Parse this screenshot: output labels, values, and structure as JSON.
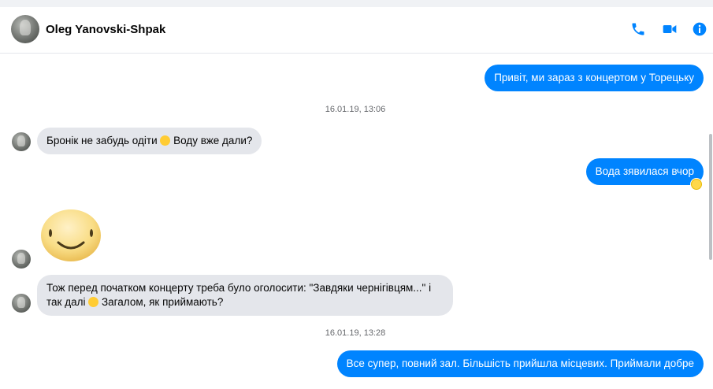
{
  "header": {
    "contact_name": "Oleg Yanovski-Shpak",
    "icons": [
      "phone-icon",
      "video-icon",
      "info-icon"
    ],
    "accent_color": "#0084ff"
  },
  "messages": [
    {
      "side": "out",
      "text": "Привіт, ми зараз з концертом у Торецьку"
    },
    {
      "type": "timestamp",
      "text": "16.01.19, 13:06"
    },
    {
      "side": "in",
      "text_before": "Бронік не забудь одіти",
      "emoji": "slightly-smiling-face",
      "text_after": "Воду вже дали?"
    },
    {
      "side": "out",
      "text": "Вода зявилася вчор",
      "reaction": "laughing-face"
    },
    {
      "side": "in",
      "sticker": "smiling-face-sticker"
    },
    {
      "side": "in",
      "text_before": "Тож перед початком концерту треба було оголосити: \"Завдяки чернігівцям...\" і так далі",
      "emoji": "slightly-smiling-face",
      "text_after": "Загалом, як приймають?"
    },
    {
      "type": "timestamp",
      "text": "16.01.19, 13:28"
    },
    {
      "side": "out",
      "text": "Все супер, повний зал. Більшість прийшла місцевих. Приймали добре"
    }
  ]
}
